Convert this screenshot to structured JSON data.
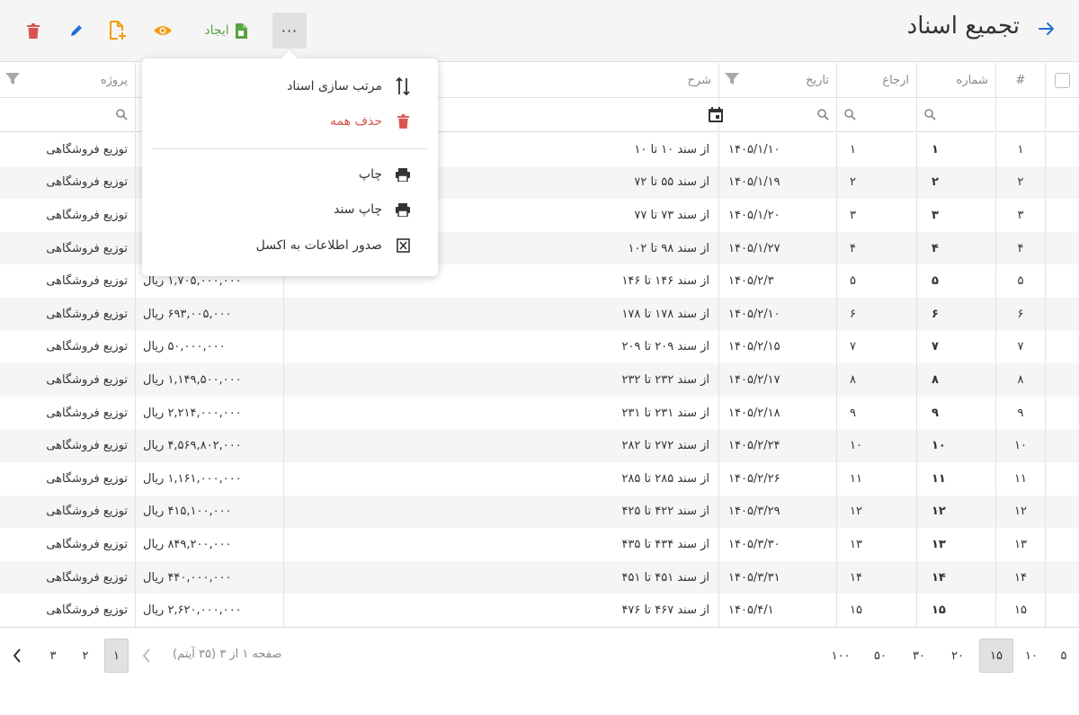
{
  "header": {
    "title": "تجمیع اسناد",
    "create_label": "ایجاد",
    "more_label": "···"
  },
  "colors": {
    "accent": "#1e6fd9",
    "danger": "#d9534f",
    "success": "#5aa33f",
    "warning": "#f39c12",
    "edit": "#1e6fd9"
  },
  "icons": {
    "back": "arrow-right-icon",
    "delete": "trash-icon",
    "edit": "pencil-icon",
    "add_file": "file-plus-icon",
    "view": "eye-icon",
    "create": "file-icon",
    "more": "ellipsis-icon"
  },
  "columns": {
    "num": "#",
    "no": "شماره",
    "ref": "ارجاع",
    "date": "تاریخ",
    "desc": "شرح",
    "proj": "پروژه"
  },
  "menu": {
    "sort_docs": "مرتب سازی اسناد",
    "delete_all": "حذف همه",
    "print": "چاپ",
    "print_doc": "چاپ سند",
    "export_excel": "صدور اطلاعات به اکسل"
  },
  "rows": [
    {
      "num": "۱",
      "no": "۱",
      "ref": "۱",
      "date": "۱۴۰۵/۱/۱۰",
      "desc": "از سند ۱۰ تا ۱۰",
      "amount": "",
      "project": "توزیع فروشگاهی"
    },
    {
      "num": "۲",
      "no": "۲",
      "ref": "۲",
      "date": "۱۴۰۵/۱/۱۹",
      "desc": "از سند ۵۵ تا ۷۲",
      "amount": "",
      "project": "توزیع فروشگاهی"
    },
    {
      "num": "۳",
      "no": "۳",
      "ref": "۳",
      "date": "۱۴۰۵/۱/۲۰",
      "desc": "از سند ۷۳ تا ۷۷",
      "amount": "",
      "project": "توزیع فروشگاهی"
    },
    {
      "num": "۴",
      "no": "۴",
      "ref": "۴",
      "date": "۱۴۰۵/۱/۲۷",
      "desc": "از سند ۹۸ تا ۱۰۲",
      "amount": "",
      "project": "توزیع فروشگاهی"
    },
    {
      "num": "۵",
      "no": "۵",
      "ref": "۵",
      "date": "۱۴۰۵/۲/۳",
      "desc": "از سند ۱۴۶ تا ۱۴۶",
      "amount": "۱,۷۰۵,۰۰۰,۰۰۰ ریال",
      "project": "توزیع فروشگاهی"
    },
    {
      "num": "۶",
      "no": "۶",
      "ref": "۶",
      "date": "۱۴۰۵/۲/۱۰",
      "desc": "از سند ۱۷۸ تا ۱۷۸",
      "amount": "۶۹۳,۰۰۵,۰۰۰ ریال",
      "project": "توزیع فروشگاهی"
    },
    {
      "num": "۷",
      "no": "۷",
      "ref": "۷",
      "date": "۱۴۰۵/۲/۱۵",
      "desc": "از سند ۲۰۹ تا ۲۰۹",
      "amount": "۵۰,۰۰۰,۰۰۰ ریال",
      "project": "توزیع فروشگاهی"
    },
    {
      "num": "۸",
      "no": "۸",
      "ref": "۸",
      "date": "۱۴۰۵/۲/۱۷",
      "desc": "از سند ۲۳۲ تا ۲۳۲",
      "amount": "۱,۱۴۹,۵۰۰,۰۰۰ ریال",
      "project": "توزیع فروشگاهی"
    },
    {
      "num": "۹",
      "no": "۹",
      "ref": "۹",
      "date": "۱۴۰۵/۲/۱۸",
      "desc": "از سند ۲۳۱ تا ۲۳۱",
      "amount": "۲,۲۱۴,۰۰۰,۰۰۰ ریال",
      "project": "توزیع فروشگاهی"
    },
    {
      "num": "۱۰",
      "no": "۱۰",
      "ref": "۱۰",
      "date": "۱۴۰۵/۲/۲۴",
      "desc": "از سند ۲۷۲ تا ۲۸۲",
      "amount": "۴,۵۶۹,۸۰۲,۰۰۰ ریال",
      "project": "توزیع فروشگاهی"
    },
    {
      "num": "۱۱",
      "no": "۱۱",
      "ref": "۱۱",
      "date": "۱۴۰۵/۲/۲۶",
      "desc": "از سند ۲۸۵ تا ۲۸۵",
      "amount": "۱,۱۶۱,۰۰۰,۰۰۰ ریال",
      "project": "توزیع فروشگاهی"
    },
    {
      "num": "۱۲",
      "no": "۱۲",
      "ref": "۱۲",
      "date": "۱۴۰۵/۳/۲۹",
      "desc": "از سند ۴۲۲ تا ۴۲۵",
      "amount": "۴۱۵,۱۰۰,۰۰۰ ریال",
      "project": "توزیع فروشگاهی"
    },
    {
      "num": "۱۳",
      "no": "۱۳",
      "ref": "۱۳",
      "date": "۱۴۰۵/۳/۳۰",
      "desc": "از سند ۴۳۴ تا ۴۳۵",
      "amount": "۸۴۹,۲۰۰,۰۰۰ ریال",
      "project": "توزیع فروشگاهی"
    },
    {
      "num": "۱۴",
      "no": "۱۴",
      "ref": "۱۴",
      "date": "۱۴۰۵/۳/۳۱",
      "desc": "از سند ۴۵۱ تا ۴۵۱",
      "amount": "۴۴۰,۰۰۰,۰۰۰ ریال",
      "project": "توزیع فروشگاهی"
    },
    {
      "num": "۱۵",
      "no": "۱۵",
      "ref": "۱۵",
      "date": "۱۴۰۵/۴/۱",
      "desc": "از سند ۴۶۷ تا ۴۷۶",
      "amount": "۲,۶۲۰,۰۰۰,۰۰۰ ریال",
      "project": "توزیع فروشگاهی"
    }
  ],
  "pager": {
    "page_sizes": [
      "۵",
      "۱۰",
      "۱۵",
      "۲۰",
      "۳۰",
      "۵۰",
      "۱۰۰"
    ],
    "selected_page_size": "۱۵",
    "info": "صفحه ۱ از ۳ (۳۵ آیتم)",
    "pages": [
      "۱",
      "۲",
      "۳"
    ],
    "current_page": "۱"
  }
}
